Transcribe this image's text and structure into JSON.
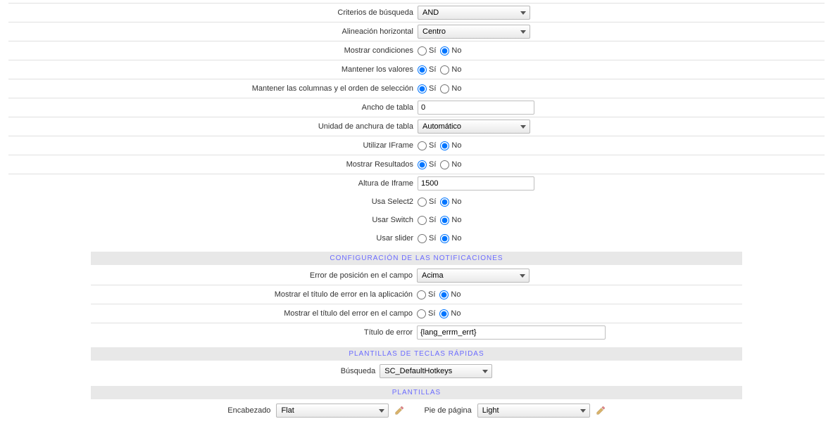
{
  "yes": "Sí",
  "no": "No",
  "rows": {
    "search_criteria": {
      "label": "Criterios de búsqueda",
      "value": "AND"
    },
    "horiz_align": {
      "label": "Alineación horizontal",
      "value": "Centro"
    },
    "show_conditions": {
      "label": "Mostrar condiciones",
      "selected": "no"
    },
    "keep_values": {
      "label": "Mantener los valores",
      "selected": "yes"
    },
    "keep_cols": {
      "label": "Mantener las columnas y el orden de selección",
      "selected": "yes"
    },
    "table_width": {
      "label": "Ancho de tabla",
      "value": "0"
    },
    "table_width_unit": {
      "label": "Unidad de anchura de tabla",
      "value": "Automático"
    },
    "use_iframe": {
      "label": "Utilizar IFrame",
      "selected": "no"
    },
    "show_results": {
      "label": "Mostrar Resultados",
      "selected": "yes"
    },
    "iframe_height": {
      "label": "Altura de Iframe",
      "value": "1500"
    },
    "use_select2": {
      "label": "Usa Select2",
      "selected": "no"
    },
    "use_switch": {
      "label": "Usar Switch",
      "selected": "no"
    },
    "use_slider": {
      "label": "Usar slider",
      "selected": "no"
    }
  },
  "notif": {
    "header": "CONFIGURACIÓN DE LAS NOTIFICACIONES",
    "err_pos": {
      "label": "Error de posición en el campo",
      "value": "Acima"
    },
    "show_err_app": {
      "label": "Mostrar el título de error en la aplicación",
      "selected": "no"
    },
    "show_err_field": {
      "label": "Mostrar el título del error en el campo",
      "selected": "no"
    },
    "err_title": {
      "label": "Título de error",
      "value": "{lang_errm_errt}"
    }
  },
  "hotkeys": {
    "header": "PLANTILLAS DE TECLAS RÁPIDAS",
    "search": {
      "label": "Búsqueda",
      "value": "SC_DefaultHotkeys"
    }
  },
  "templates": {
    "header": "PLANTILLAS",
    "header_label": "Encabezado",
    "header_value": "Flat",
    "footer_label": "Pie de página",
    "footer_value": "Light"
  }
}
